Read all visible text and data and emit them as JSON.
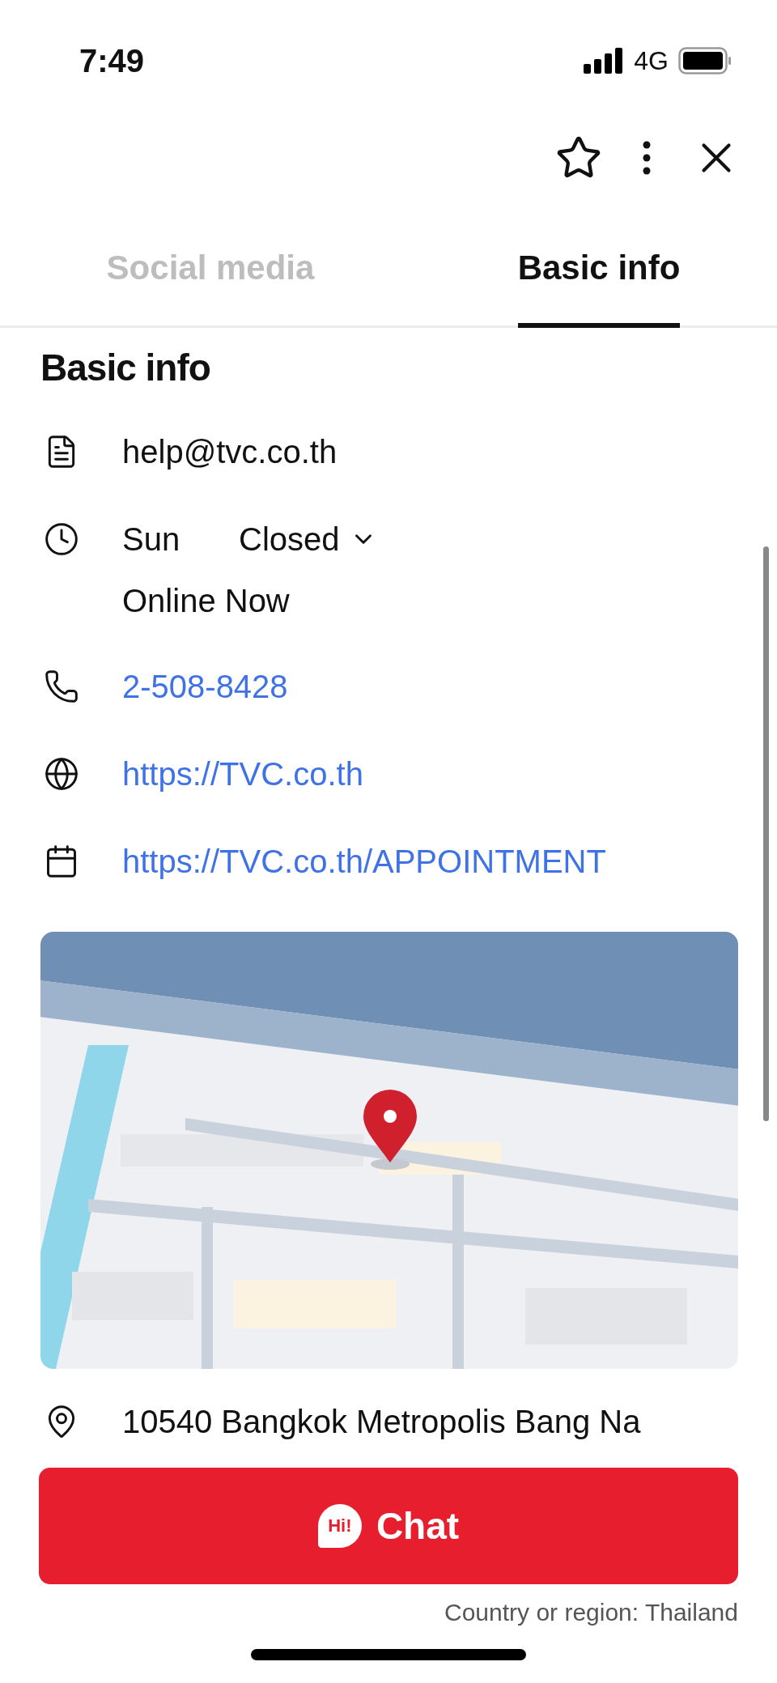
{
  "status_bar": {
    "time": "7:49",
    "network": "4G"
  },
  "tabs": [
    {
      "label": "Social media",
      "selected": false
    },
    {
      "label": "Basic info",
      "selected": true
    }
  ],
  "section_title": "Basic info",
  "info_rows": [
    {
      "kind": "email",
      "text": "help@tvc.co.th",
      "link": false
    },
    {
      "kind": "hours",
      "day": "Sun",
      "status": "Closed",
      "note": "Online Now",
      "expanded": false
    },
    {
      "kind": "phone",
      "text": "2-508-8428",
      "link": true
    },
    {
      "kind": "website",
      "text": "https://TVC.co.th",
      "link": true
    },
    {
      "kind": "appointment",
      "text": "https://TVC.co.th/APPOINTMENT",
      "link": true
    }
  ],
  "address": "10540 Bangkok Metropolis Bang Na",
  "chat_button": {
    "badge": "Hi!",
    "label": "Chat"
  },
  "footer": "Country or region: Thailand"
}
